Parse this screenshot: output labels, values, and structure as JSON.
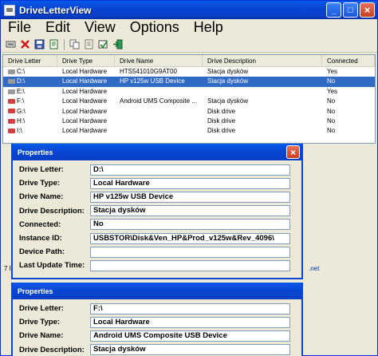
{
  "window": {
    "title": "DriveLetterView",
    "buttons": {
      "minimize": "_",
      "maximize": "□",
      "close": "×"
    }
  },
  "menu": [
    "File",
    "Edit",
    "View",
    "Options",
    "Help"
  ],
  "toolbar": [
    "copy-icon",
    "delete-icon",
    "save-icon",
    "properties-icon",
    "copy-html-icon",
    "copy-text-icon",
    "refresh-icon",
    "exit-icon"
  ],
  "list": {
    "columns": [
      "Drive Letter",
      "Drive Type",
      "Drive Name",
      "Drive Description",
      "Connected"
    ],
    "rows": [
      {
        "letter": "C:\\",
        "type": "Local Hardware",
        "name": "HTS541010G9AT00",
        "desc": "Stacja dysków",
        "connected": "Yes",
        "icon_color": "#9a9a9a"
      },
      {
        "letter": "D:\\",
        "type": "Local Hardware",
        "name": "HP v125w USB Device",
        "desc": "Stacja dysków",
        "connected": "No",
        "icon_color": "#9a9a9a"
      },
      {
        "letter": "E:\\",
        "type": "Local Hardware",
        "name": "",
        "desc": "",
        "connected": "Yes",
        "icon_color": "#9a9a9a"
      },
      {
        "letter": "F:\\",
        "type": "Local Hardware",
        "name": "Android   UMS Composite ...",
        "desc": "Stacja dysków",
        "connected": "No",
        "icon_color": "#d04040"
      },
      {
        "letter": "G:\\",
        "type": "Local Hardware",
        "name": "",
        "desc": "Disk drive",
        "connected": "No",
        "icon_color": "#d04040"
      },
      {
        "letter": "H:\\",
        "type": "Local Hardware",
        "name": "",
        "desc": "Disk drive",
        "connected": "No",
        "icon_color": "#d04040"
      },
      {
        "letter": "I:\\",
        "type": "Local Hardware",
        "name": "",
        "desc": "Disk drive",
        "connected": "No",
        "icon_color": "#d04040"
      }
    ],
    "selected_index": 1
  },
  "status": {
    "left": "7 I",
    "right": ".net"
  },
  "dialog1": {
    "title": "Properties",
    "close": "×",
    "fields": [
      {
        "label": "Drive Letter:",
        "value": "D:\\"
      },
      {
        "label": "Drive Type:",
        "value": "Local Hardware"
      },
      {
        "label": "Drive Name:",
        "value": "HP v125w USB Device"
      },
      {
        "label": "Drive Description:",
        "value": "Stacja dysków"
      },
      {
        "label": "Connected:",
        "value": "No"
      },
      {
        "label": "Instance ID:",
        "value": "USBSTOR\\Disk&Ven_HP&Prod_v125w&Rev_4096\\"
      },
      {
        "label": "Device Path:",
        "value": ""
      },
      {
        "label": "Last Update Time:",
        "value": ""
      }
    ]
  },
  "dialog2": {
    "title": "Properties",
    "fields": [
      {
        "label": "Drive Letter:",
        "value": "F:\\"
      },
      {
        "label": "Drive Type:",
        "value": "Local Hardware"
      },
      {
        "label": "Drive Name:",
        "value": "Android   UMS Composite USB Device"
      },
      {
        "label": "Drive Description:",
        "value": "Stacja dysków"
      }
    ]
  }
}
